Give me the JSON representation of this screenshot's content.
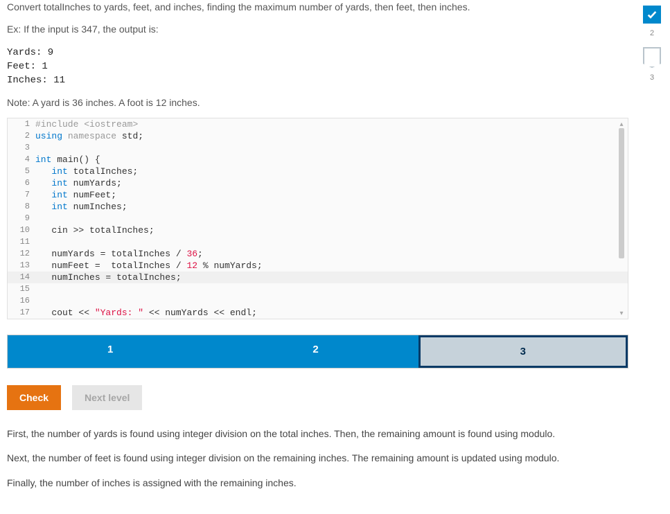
{
  "problem": {
    "description": "Convert totalInches to yards, feet, and inches, finding the maximum number of yards, then feet, then inches.",
    "example_lead": "Ex: If the input is 347, the output is:",
    "example_output": "Yards: 9\nFeet: 1\nInches: 11",
    "note": "Note: A yard is 36 inches. A foot is 12 inches."
  },
  "code_lines": [
    {
      "n": 1,
      "html": "<span class='tok-preproc'>#include</span> <span class='tok-preproc'>&lt;iostream&gt;</span>"
    },
    {
      "n": 2,
      "html": "<span class='tok-kw'>using</span> <span class='tok-ns'>namespace</span> std;"
    },
    {
      "n": 3,
      "html": ""
    },
    {
      "n": 4,
      "html": "<span class='tok-type'>int</span> <span class='tok-id'>main</span>() {"
    },
    {
      "n": 5,
      "html": "   <span class='tok-type'>int</span> totalInches;"
    },
    {
      "n": 6,
      "html": "   <span class='tok-type'>int</span> numYards;"
    },
    {
      "n": 7,
      "html": "   <span class='tok-type'>int</span> numFeet;"
    },
    {
      "n": 8,
      "html": "   <span class='tok-type'>int</span> numInches;"
    },
    {
      "n": 9,
      "html": ""
    },
    {
      "n": 10,
      "html": "   cin &gt;&gt; totalInches;"
    },
    {
      "n": 11,
      "html": ""
    },
    {
      "n": 12,
      "html": "   numYards = totalInches / <span class='tok-num'>36</span>;"
    },
    {
      "n": 13,
      "html": "   numFeet =  totalInches / <span class='tok-num'>12</span> % numYards;"
    },
    {
      "n": 14,
      "html": "   numInches = totalInches;",
      "hl": true
    },
    {
      "n": 15,
      "html": ""
    },
    {
      "n": 16,
      "html": ""
    },
    {
      "n": 17,
      "html": "   cout &lt;&lt; <span class='tok-str'>\"Yards: \"</span> &lt;&lt; numYards &lt;&lt; endl;"
    }
  ],
  "tabs": [
    "1",
    "2",
    "3"
  ],
  "active_tab_index": 0,
  "selected_tab_index": 2,
  "buttons": {
    "check": "Check",
    "next": "Next level"
  },
  "explanation": [
    "First, the number of yards is found using integer division on the total inches. Then, the remaining amount is found using modulo.",
    "Next, the number of feet is found using integer division on the remaining inches. The remaining amount is updated using modulo.",
    "Finally, the number of inches is assigned with the remaining inches."
  ],
  "sidebar": {
    "items": [
      {
        "label": "2",
        "done": true,
        "type": "check"
      },
      {
        "label": "3",
        "done": false,
        "type": "bookmark"
      }
    ]
  }
}
